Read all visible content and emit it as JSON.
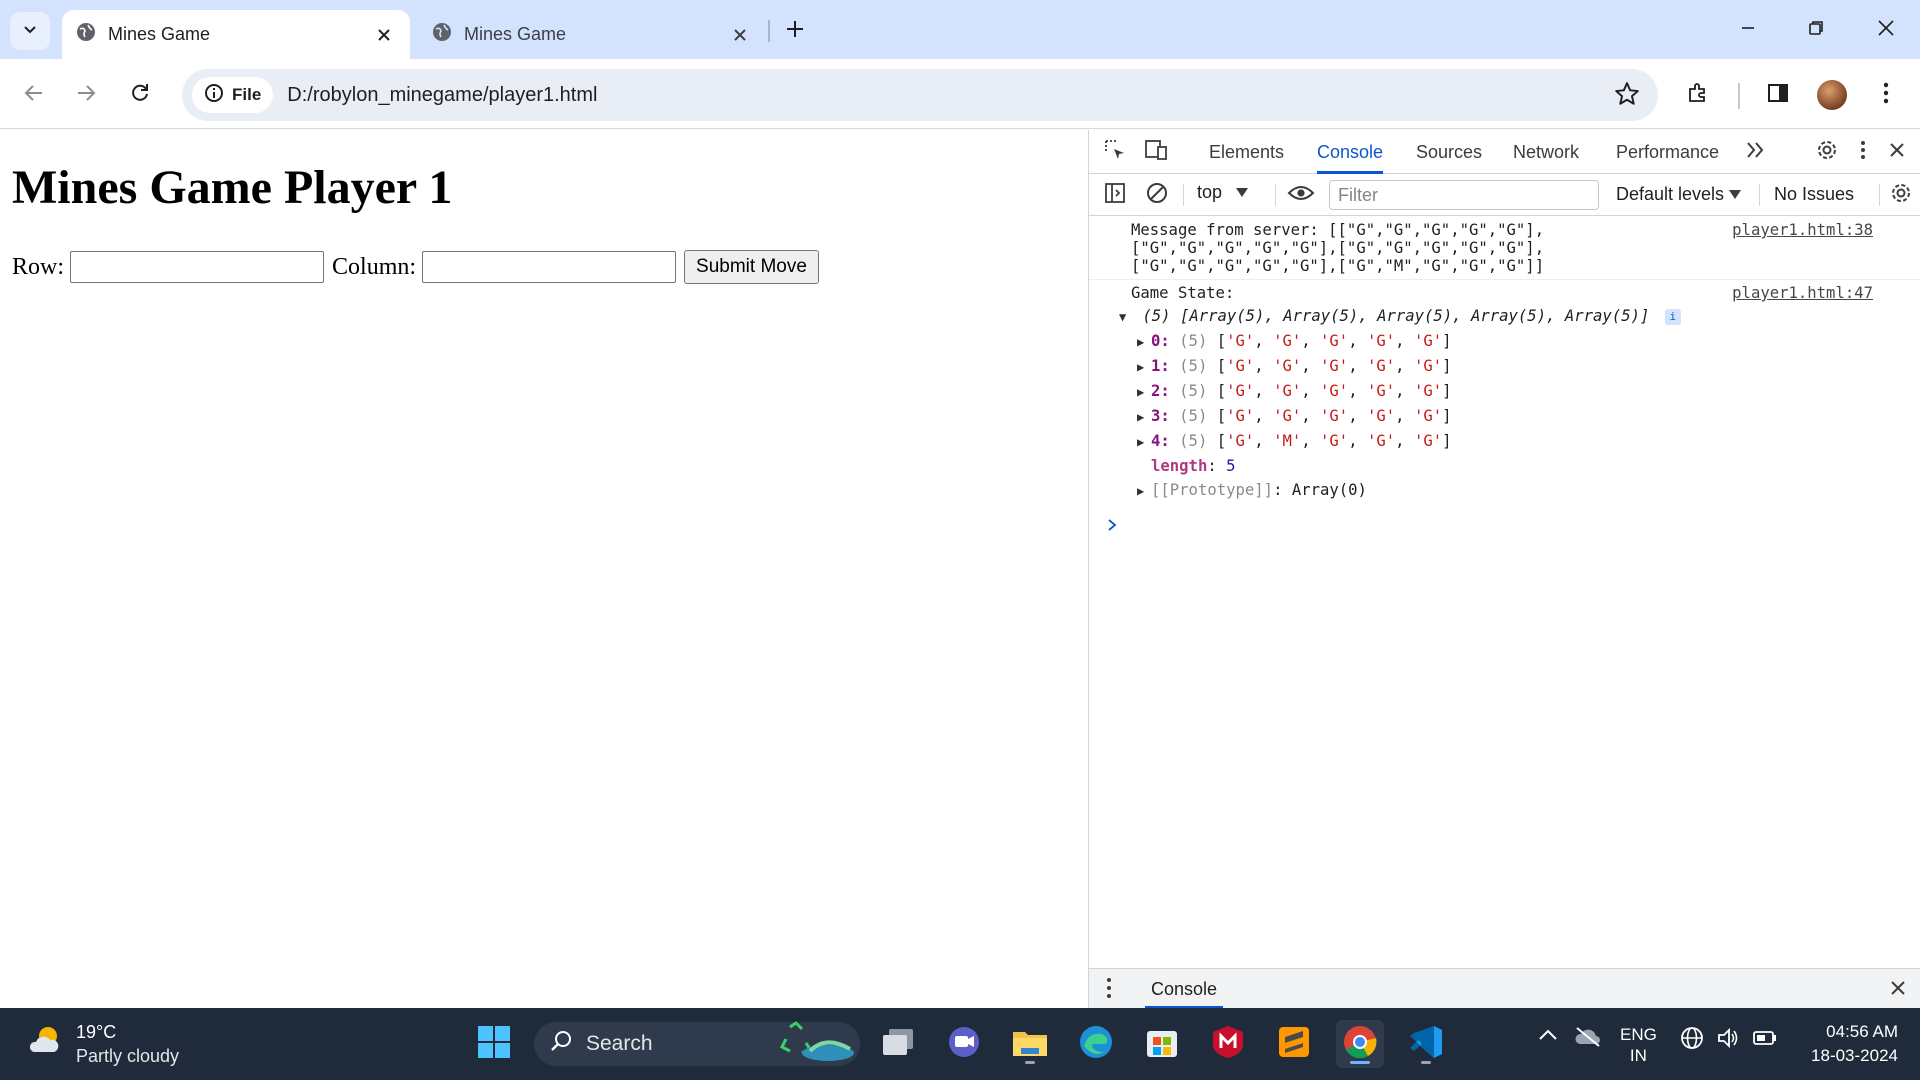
{
  "browser": {
    "tabs": [
      {
        "title": "Mines Game",
        "active": true
      },
      {
        "title": "Mines Game",
        "active": false
      }
    ],
    "address": {
      "scheme_label": "File",
      "url": "D:/robylon_minegame/player1.html"
    }
  },
  "page": {
    "heading": "Mines Game Player 1",
    "row_label": "Row:",
    "column_label": "Column:",
    "row_value": "",
    "column_value": "",
    "submit_label": "Submit Move"
  },
  "devtools": {
    "tabs": [
      "Elements",
      "Console",
      "Sources",
      "Network",
      "Performance"
    ],
    "active_tab": "Console",
    "context": "top",
    "filter_placeholder": "Filter",
    "levels": "Default levels",
    "issues": "No Issues",
    "console": {
      "message1": {
        "text": "Message from server: [[\"G\",\"G\",\"G\",\"G\",\"G\"],[\"G\",\"G\",\"G\",\"G\",\"G\"],[\"G\",\"G\",\"G\",\"G\",\"G\"],[\"G\",\"G\",\"G\",\"G\",\"G\"],[\"G\",\"M\",\"G\",\"G\",\"G\"]]",
        "source": "player1.html:38"
      },
      "message2": {
        "label": "Game State:",
        "source": "player1.html:47",
        "summary": "(5) [Array(5), Array(5), Array(5), Array(5), Array(5)]",
        "rows": [
          {
            "index": "0",
            "count": "(5)",
            "values": [
              "G",
              "G",
              "G",
              "G",
              "G"
            ]
          },
          {
            "index": "1",
            "count": "(5)",
            "values": [
              "G",
              "G",
              "G",
              "G",
              "G"
            ]
          },
          {
            "index": "2",
            "count": "(5)",
            "values": [
              "G",
              "G",
              "G",
              "G",
              "G"
            ]
          },
          {
            "index": "3",
            "count": "(5)",
            "values": [
              "G",
              "G",
              "G",
              "G",
              "G"
            ]
          },
          {
            "index": "4",
            "count": "(5)",
            "values": [
              "G",
              "M",
              "G",
              "G",
              "G"
            ]
          }
        ],
        "length_key": "length",
        "length_value": "5",
        "prototype_key": "[[Prototype]]",
        "prototype_value": "Array(0)"
      }
    },
    "drawer_tab": "Console"
  },
  "taskbar": {
    "weather_temp": "19°C",
    "weather_desc": "Partly cloudy",
    "search_label": "Search",
    "lang_top": "ENG",
    "lang_bottom": "IN",
    "time": "04:56 AM",
    "date": "18-03-2024"
  }
}
